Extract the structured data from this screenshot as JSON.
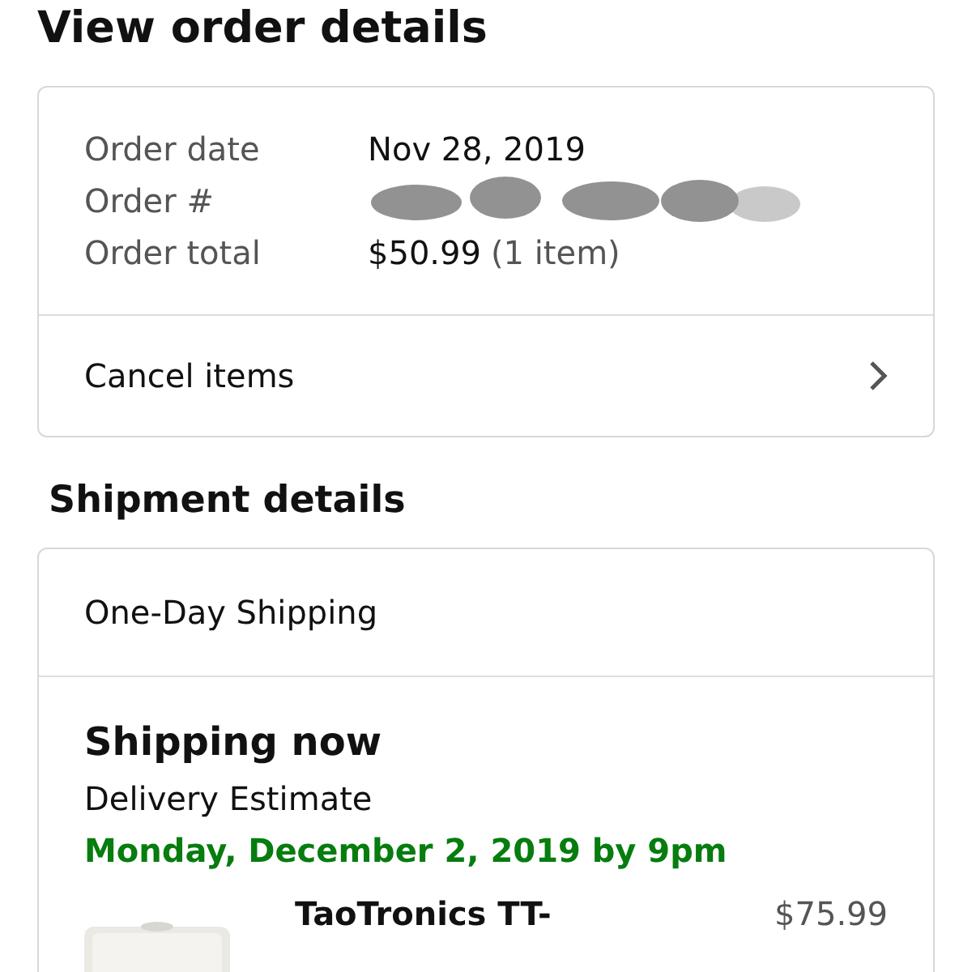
{
  "title": "View order details",
  "order": {
    "rows": [
      {
        "label": "Order date",
        "kind": "text",
        "value": "Nov 28, 2019"
      },
      {
        "label": "Order #",
        "kind": "redacted"
      },
      {
        "label": "Order total",
        "kind": "total",
        "value": "$50.99",
        "note": "(1 item)"
      }
    ],
    "action": "Cancel items"
  },
  "shipment": {
    "heading": "Shipment details",
    "method": "One-Day Shipping",
    "status": "Shipping now",
    "estimate_label": "Delivery Estimate",
    "estimate": "Monday, December 2, 2019 by 9pm",
    "items": [
      {
        "name": "TaoTronics TT-",
        "price": "$75.99"
      }
    ]
  }
}
